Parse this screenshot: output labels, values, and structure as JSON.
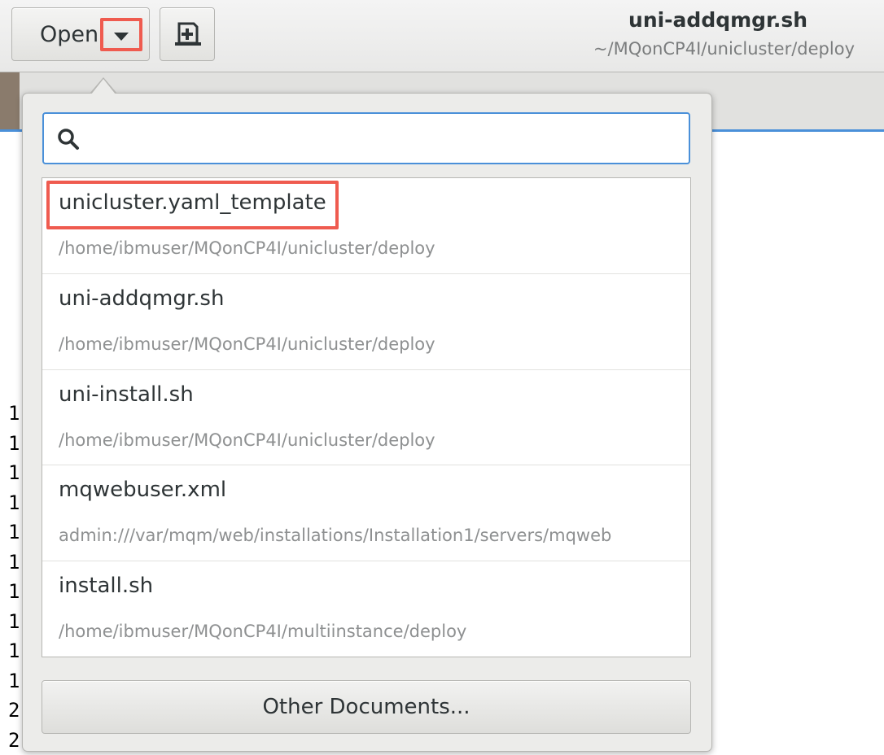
{
  "header": {
    "open_label": "Open",
    "title": "uni-addqmgr.sh",
    "subtitle": "~/MQonCP4I/unicluster/deploy"
  },
  "popover": {
    "search": {
      "value": "",
      "placeholder": ""
    },
    "recent_files": [
      {
        "name": "unicluster.yaml_template",
        "path": "/home/ibmuser/MQonCP4I/unicluster/deploy"
      },
      {
        "name": "uni-addqmgr.sh",
        "path": "/home/ibmuser/MQonCP4I/unicluster/deploy"
      },
      {
        "name": "uni-install.sh",
        "path": "/home/ibmuser/MQonCP4I/unicluster/deploy"
      },
      {
        "name": "mqwebuser.xml",
        "path": "admin:///var/mqm/web/installations/Installation1/servers/mqweb"
      },
      {
        "name": "install.sh",
        "path": "/home/ibmuser/MQonCP4I/multiinstance/deploy"
      }
    ],
    "other_documents_label": "Other Documents..."
  },
  "editor": {
    "line_numbers": [
      "1",
      "1",
      "1",
      "1",
      "1",
      "1",
      "1",
      "1",
      "1",
      "1",
      "2",
      "2"
    ]
  },
  "colors": {
    "accent": "#4a90d9",
    "highlight": "#ef5b4f"
  },
  "icons": {
    "dropdown": "chevron-down-icon",
    "new_document": "new-document-icon",
    "search": "search-icon"
  }
}
